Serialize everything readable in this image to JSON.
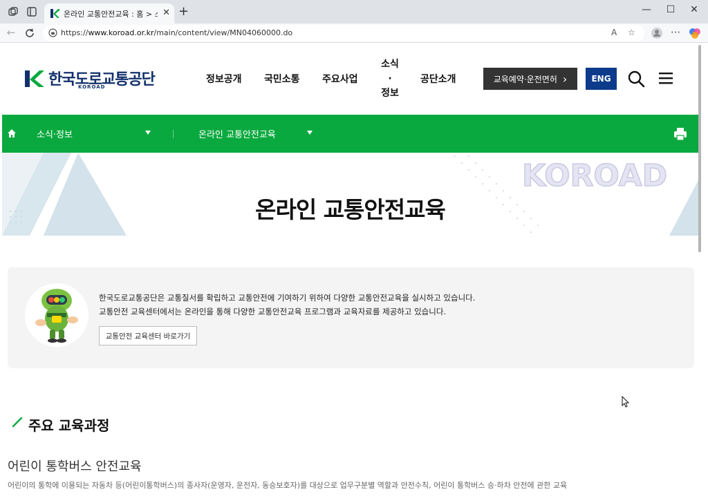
{
  "browser": {
    "tab_title": "온라인 교통안전교육 : 홈 > 소식",
    "tab_close": "✕",
    "new_tab": "+",
    "url_prefix": "https://",
    "url_host": "www.koroad.or.kr",
    "url_path": "/main/content/view/MN04060000.do",
    "window_min": "—",
    "window_max": "☐",
    "window_close": "✕"
  },
  "header": {
    "logo_text": "한국도로교통공단",
    "logo_sub": "KOROAD",
    "nav": [
      {
        "label": "정보공개"
      },
      {
        "label": "국민소통"
      },
      {
        "label": "주요사업"
      },
      {
        "label": "소식·정보",
        "lines": [
          "소식",
          "·",
          "정보"
        ]
      },
      {
        "label": "공단소개"
      }
    ],
    "edu_button": "교육예약·운전면허",
    "edu_arrow": "›",
    "eng_button": "ENG"
  },
  "breadcrumb": {
    "level1": "소식·정보",
    "level2": "온라인 교통안전교육"
  },
  "hero": {
    "title": "온라인 교통안전교육",
    "watermark": "KOROAD"
  },
  "intro": {
    "line1": "한국도로교통공단은 교통질서를 확립하고 교통안전에 기여하기 위하여 다양한 교통안전교육을 실시하고 있습니다.",
    "line2": "교통안전 교육센터에서는 온라인을 통해 다양한 교통안전교육 프로그램과 교육자료를 제공하고 있습니다.",
    "button": "교통안전 교육센터 바로가기"
  },
  "courses": {
    "section_title": "주요 교육과정",
    "items": [
      {
        "title": "어린이 통학버스 안전교육",
        "description": "어린이의 통학에 이용되는 자동차 등(어린이통학버스)의 종사자(운영자, 운전자, 동승보호자)를 대상으로 업무구분별 역할과 안전수칙, 어린이 통학버스 승·하차 안전에 관한 교육"
      }
    ]
  },
  "colors": {
    "brand_navy": "#12306b",
    "brand_green": "#0aa93f",
    "eng_blue": "#0d3b8c",
    "dark_button": "#333333"
  }
}
